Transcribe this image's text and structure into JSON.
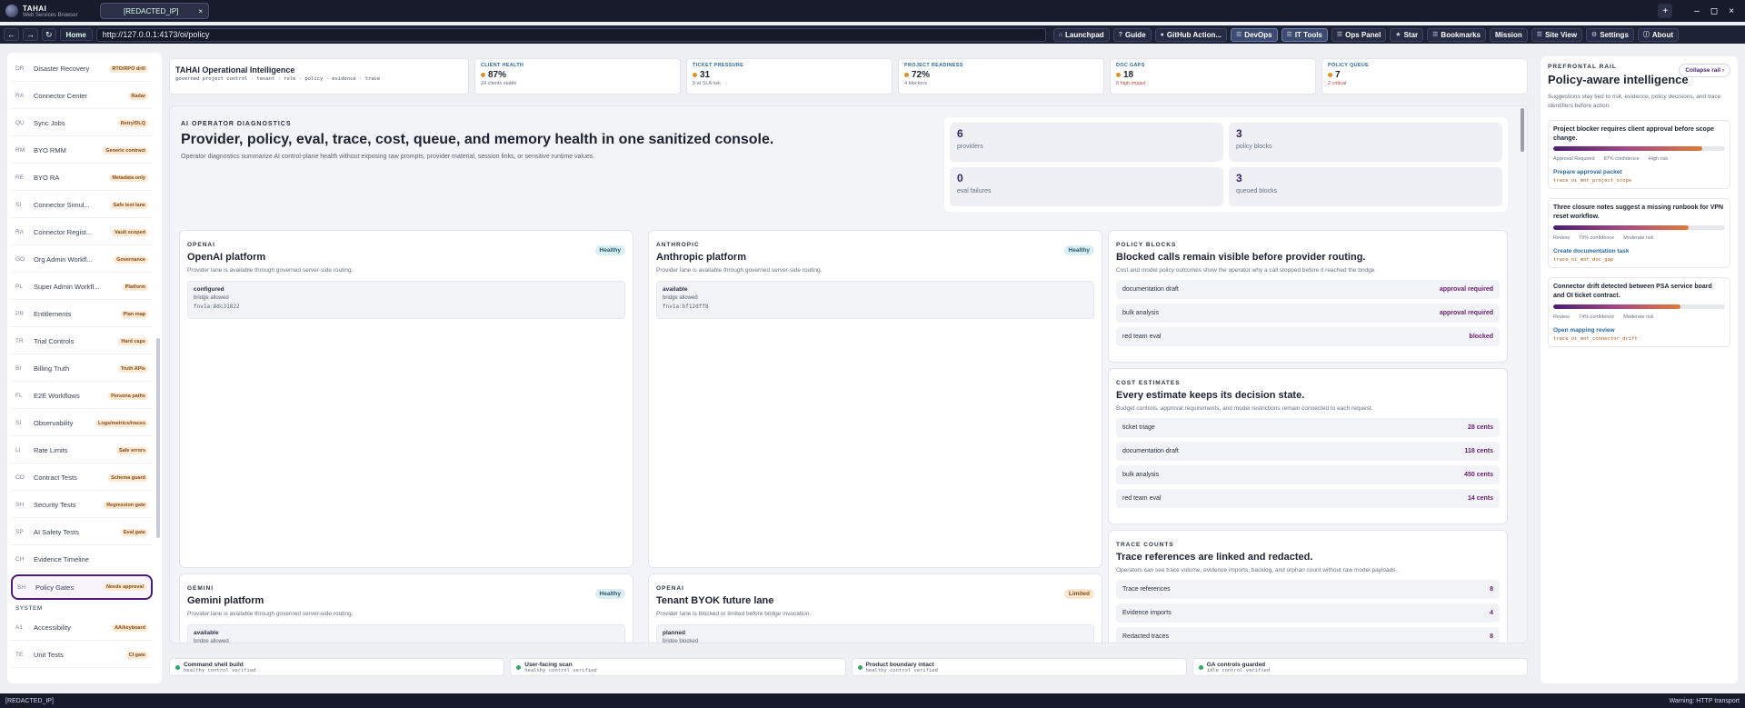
{
  "app": {
    "brand": "TAHAI",
    "subtitle": "Web Services Browser",
    "tab_title": "[REDACTED_IP]",
    "close_glyph": "×"
  },
  "window": {
    "plus": "+",
    "min": "–",
    "max": "◻",
    "close": "×"
  },
  "nav": {
    "back": "←",
    "forward": "→",
    "reload": "↻",
    "home": "Home",
    "url": "http://127.0.0.1:4173/oi/policy"
  },
  "toolbar": [
    {
      "icon": "⌂",
      "label": "Launchpad"
    },
    {
      "icon": "?",
      "label": "Guide"
    },
    {
      "icon": "●",
      "label": "GitHub Action..."
    },
    {
      "icon": "☰",
      "label": "DevOps"
    },
    {
      "icon": "☰",
      "label": "IT Tools"
    },
    {
      "icon": "☰",
      "label": "Ops Panel"
    },
    {
      "icon": "★",
      "label": "Star"
    },
    {
      "icon": "☰",
      "label": "Bookmarks"
    },
    {
      "icon": "",
      "label": "Mission"
    },
    {
      "icon": "☰",
      "label": "Site View"
    },
    {
      "icon": "⚙",
      "label": "Settings"
    },
    {
      "icon": "ⓘ",
      "label": "About"
    }
  ],
  "sidebar": {
    "items": [
      {
        "abbr": "DR",
        "label": "Disaster Recovery",
        "badge": "RTO/RPO drill"
      },
      {
        "abbr": "RA",
        "label": "Connector Center",
        "badge": "Radar"
      },
      {
        "abbr": "QU",
        "label": "Sync Jobs",
        "badge": "Retry/DLQ"
      },
      {
        "abbr": "RM",
        "label": "BYO RMM",
        "badge": "Generic contract"
      },
      {
        "abbr": "RE",
        "label": "BYO RA",
        "badge": "Metadata only"
      },
      {
        "abbr": "SI",
        "label": "Connector Simul...",
        "badge": "Safe test lane"
      },
      {
        "abbr": "RA",
        "label": "Connector Regist...",
        "badge": "Vault scoped"
      },
      {
        "abbr": "GO",
        "label": "Org Admin Workfl...",
        "badge": "Governance"
      },
      {
        "abbr": "PL",
        "label": "Super Admin Workfl...",
        "badge": "Platform"
      },
      {
        "abbr": "PR",
        "label": "Entitlements",
        "badge": "Plan map"
      },
      {
        "abbr": "TR",
        "label": "Trial Controls",
        "badge": "Hard caps"
      },
      {
        "abbr": "BI",
        "label": "Billing Truth",
        "badge": "Truth APIs"
      },
      {
        "abbr": "FL",
        "label": "E2E Workflows",
        "badge": "Persona paths"
      },
      {
        "abbr": "SI",
        "label": "Observability",
        "badge": "Logs/metrics/traces"
      },
      {
        "abbr": "LI",
        "label": "Rate Limits",
        "badge": "Safe errors"
      },
      {
        "abbr": "CO",
        "label": "Contract Tests",
        "badge": "Schema guard"
      },
      {
        "abbr": "SH",
        "label": "Security Tests",
        "badge": "Regression gate"
      },
      {
        "abbr": "SP",
        "label": "AI Safety Tests",
        "badge": "Eval gate"
      },
      {
        "abbr": "CH",
        "label": "Evidence Timeline",
        "badge": ""
      },
      {
        "abbr": "SH",
        "label": "Policy Gates",
        "badge": "Needs approval",
        "selected": true
      }
    ],
    "system_header": "SYSTEM",
    "system_items": [
      {
        "abbr": "A1",
        "label": "Accessibility",
        "badge": "AA/keyboard"
      },
      {
        "abbr": "TE",
        "label": "Unit Tests",
        "badge": "CI gate"
      }
    ]
  },
  "kpis": {
    "title": "TAHAI Operational Intelligence",
    "title_sub": "governed project control · tenant · role · policy · evidence · trace",
    "cards": [
      {
        "label": "CLIENT HEALTH",
        "value": "87%",
        "sub": "24 clients stable",
        "sub_red": false
      },
      {
        "label": "TICKET PRESSURE",
        "value": "31",
        "sub": "9 at SLA risk",
        "sub_red": false
      },
      {
        "label": "PROJECT READINESS",
        "value": "72%",
        "sub": "4 blockers",
        "sub_red": false
      },
      {
        "label": "DOC GAPS",
        "value": "18",
        "sub": "6 high impact",
        "sub_red": true
      },
      {
        "label": "POLICY QUEUE",
        "value": "7",
        "sub": "2 critical",
        "sub_red": true
      }
    ]
  },
  "hero": {
    "eyebrow": "AI OPERATOR DIAGNOSTICS",
    "title": "Provider, policy, eval, trace, cost, queue, and memory health in one sanitized console.",
    "desc": "Operator diagnostics summarize AI control-plane health without exposing raw prompts, provider material, session links, or sensitive runtime values."
  },
  "stats": [
    {
      "num": "6",
      "label": "providers"
    },
    {
      "num": "3",
      "label": "policy blocks"
    },
    {
      "num": "0",
      "label": "eval failures"
    },
    {
      "num": "3",
      "label": "queued blocks"
    }
  ],
  "providers": [
    {
      "eyebrow": "OPENAI",
      "title": "OpenAI platform",
      "desc": "Provider lane is available through governed server-side routing.",
      "status": "Healthy",
      "state": "configured",
      "bridge": "bridge allowed",
      "hash": "fnv1a:8dc31822"
    },
    {
      "eyebrow": "ANTHROPIC",
      "title": "Anthropic platform",
      "desc": "Provider lane is available through governed server-side routing.",
      "status": "Healthy",
      "state": "available",
      "bridge": "bridge allowed",
      "hash": "fnv1a:bf12dff8"
    },
    {
      "eyebrow": "GEMINI",
      "title": "Gemini platform",
      "desc": "Provider lane is available through governed server-side routing.",
      "status": "Healthy",
      "state": "available",
      "bridge": "bridge allowed",
      "hash": ""
    },
    {
      "eyebrow": "OPENAI",
      "title": "Tenant BYOK future lane",
      "desc": "Provider lane is blocked or limited before bridge invocation.",
      "status": "Limited",
      "state": "planned",
      "bridge": "bridge blocked",
      "hash": ""
    }
  ],
  "policy_blocks": {
    "eyebrow": "POLICY BLOCKS",
    "title": "Blocked calls remain visible before provider routing.",
    "desc": "Cost and model policy outcomes show the operator why a call stopped before it reached the bridge.",
    "rows": [
      {
        "k": "documentation draft",
        "v": "approval required"
      },
      {
        "k": "bulk analysis",
        "v": "approval required"
      },
      {
        "k": "red team eval",
        "v": "blocked"
      }
    ]
  },
  "cost_estimates": {
    "eyebrow": "COST ESTIMATES",
    "title": "Every estimate keeps its decision state.",
    "desc": "Budget controls, approval requirements, and model restrictions remain connected to each request.",
    "rows": [
      {
        "k": "ticket triage",
        "v": "28 cents"
      },
      {
        "k": "documentation draft",
        "v": "118 cents"
      },
      {
        "k": "bulk analysis",
        "v": "450 cents"
      },
      {
        "k": "red team eval",
        "v": "14 cents"
      }
    ]
  },
  "trace_counts": {
    "eyebrow": "TRACE COUNTS",
    "title": "Trace references are linked and redacted.",
    "desc": "Operators can see trace volume, evidence imports, backlog, and orphan count without raw model payloads.",
    "rows": [
      {
        "k": "Trace references",
        "v": "8"
      },
      {
        "k": "Evidence imports",
        "v": "4"
      },
      {
        "k": "Redacted traces",
        "v": "8"
      }
    ]
  },
  "footer": [
    {
      "title": "Command shell build",
      "sub": "healthy control verified"
    },
    {
      "title": "User-facing scan",
      "sub": "healthy control verified"
    },
    {
      "title": "Product boundary intact",
      "sub": "healthy control verified"
    },
    {
      "title": "GA controls guarded",
      "sub": "idle control verified"
    }
  ],
  "rail": {
    "eyebrow": "PREFRONTAL RAIL",
    "title": "Policy-aware intelligence",
    "desc": "Suggestions stay tied to risk, evidence, policy decisions, and trace identifiers before action.",
    "collapse": "Collapse rail",
    "cards": [
      {
        "title": "Project blocker requires client approval before scope change.",
        "confidence": 0.87,
        "meta1": "Approval Required",
        "meta2": "87% confidence",
        "meta3": "High risk",
        "action": "Prepare approval packet",
        "trace": "trace_oi_mnt_project_scope"
      },
      {
        "title": "Three closure notes suggest a missing runbook for VPN reset workflow.",
        "confidence": 0.79,
        "meta1": "Review",
        "meta2": "79% confidence",
        "meta3": "Moderate risk",
        "action": "Create documentation task",
        "trace": "trace_oi_mnt_doc_gap"
      },
      {
        "title": "Connector drift detected between PSA service board and OI ticket contract.",
        "confidence": 0.74,
        "meta1": "Review",
        "meta2": "74% confidence",
        "meta3": "Moderate risk",
        "action": "Open mapping review",
        "trace": "trace_oi_mnt_connector_drift"
      }
    ]
  },
  "status": {
    "left": "[REDACTED_IP]",
    "right": "Warning: HTTP transport"
  }
}
